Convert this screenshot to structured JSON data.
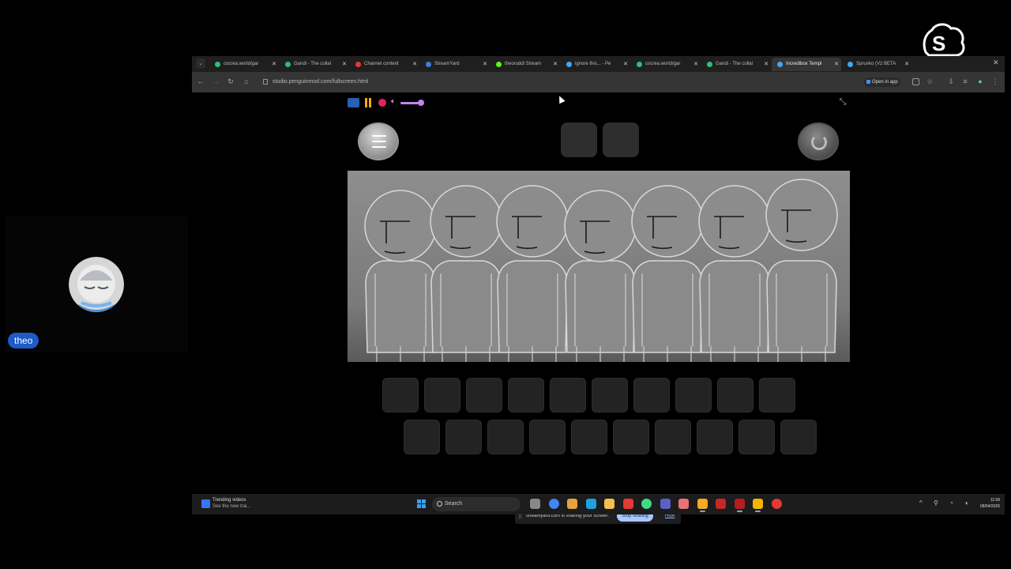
{
  "overlay": {
    "brand": "streamyard",
    "participant_name": "theo"
  },
  "browser": {
    "tabs": [
      {
        "title": "cocrea.world/gar",
        "icon": "cocrea-icon",
        "color": "#2fbf71"
      },
      {
        "title": "Gandi - The collal",
        "icon": "gandi-icon",
        "color": "#2fbf71"
      },
      {
        "title": "Channel content",
        "icon": "youtube-icon",
        "color": "#e53935"
      },
      {
        "title": "StreamYard",
        "icon": "streamyard-icon",
        "color": "#3f7be0"
      },
      {
        "title": "theoruddi Stream",
        "icon": "kick-icon",
        "color": "#53fc18"
      },
      {
        "title": "ignore this... - Pe",
        "icon": "penguinmod-icon",
        "color": "#3fa9f5"
      },
      {
        "title": "cocrea.world/gar",
        "icon": "cocrea-icon",
        "color": "#2fbf71"
      },
      {
        "title": "Gandi - The collal",
        "icon": "gandi-icon",
        "color": "#2fbf71"
      },
      {
        "title": "Incredibox Templ",
        "icon": "penguinmod-icon",
        "color": "#3fa9f5"
      },
      {
        "title": "Sprunko (V2 BETA",
        "icon": "penguinmod-icon",
        "color": "#3fa9f5"
      }
    ],
    "url": "studio.penguinmod.com/fullscreen.html",
    "open_in_app": "Open in app"
  },
  "share_banner": {
    "message": "streamyard.com is sharing your screen.",
    "stop_label": "Stop sharing",
    "hide_label": "Hide"
  },
  "taskbar": {
    "news_title": "Trending videos",
    "news_sub": "See the new trai...",
    "search_placeholder": "Search",
    "time": "11:58",
    "date": "08/04/2026",
    "icons": [
      "task-view-icon",
      "chrome-icon",
      "app-icon",
      "edge-icon",
      "file-explorer-icon",
      "youtube-icon",
      "chrome-beta-icon",
      "teams-icon",
      "app-icon",
      "chrome-canary-icon",
      "app-icon",
      "app-icon",
      "app-icon",
      "obs-icon"
    ]
  }
}
